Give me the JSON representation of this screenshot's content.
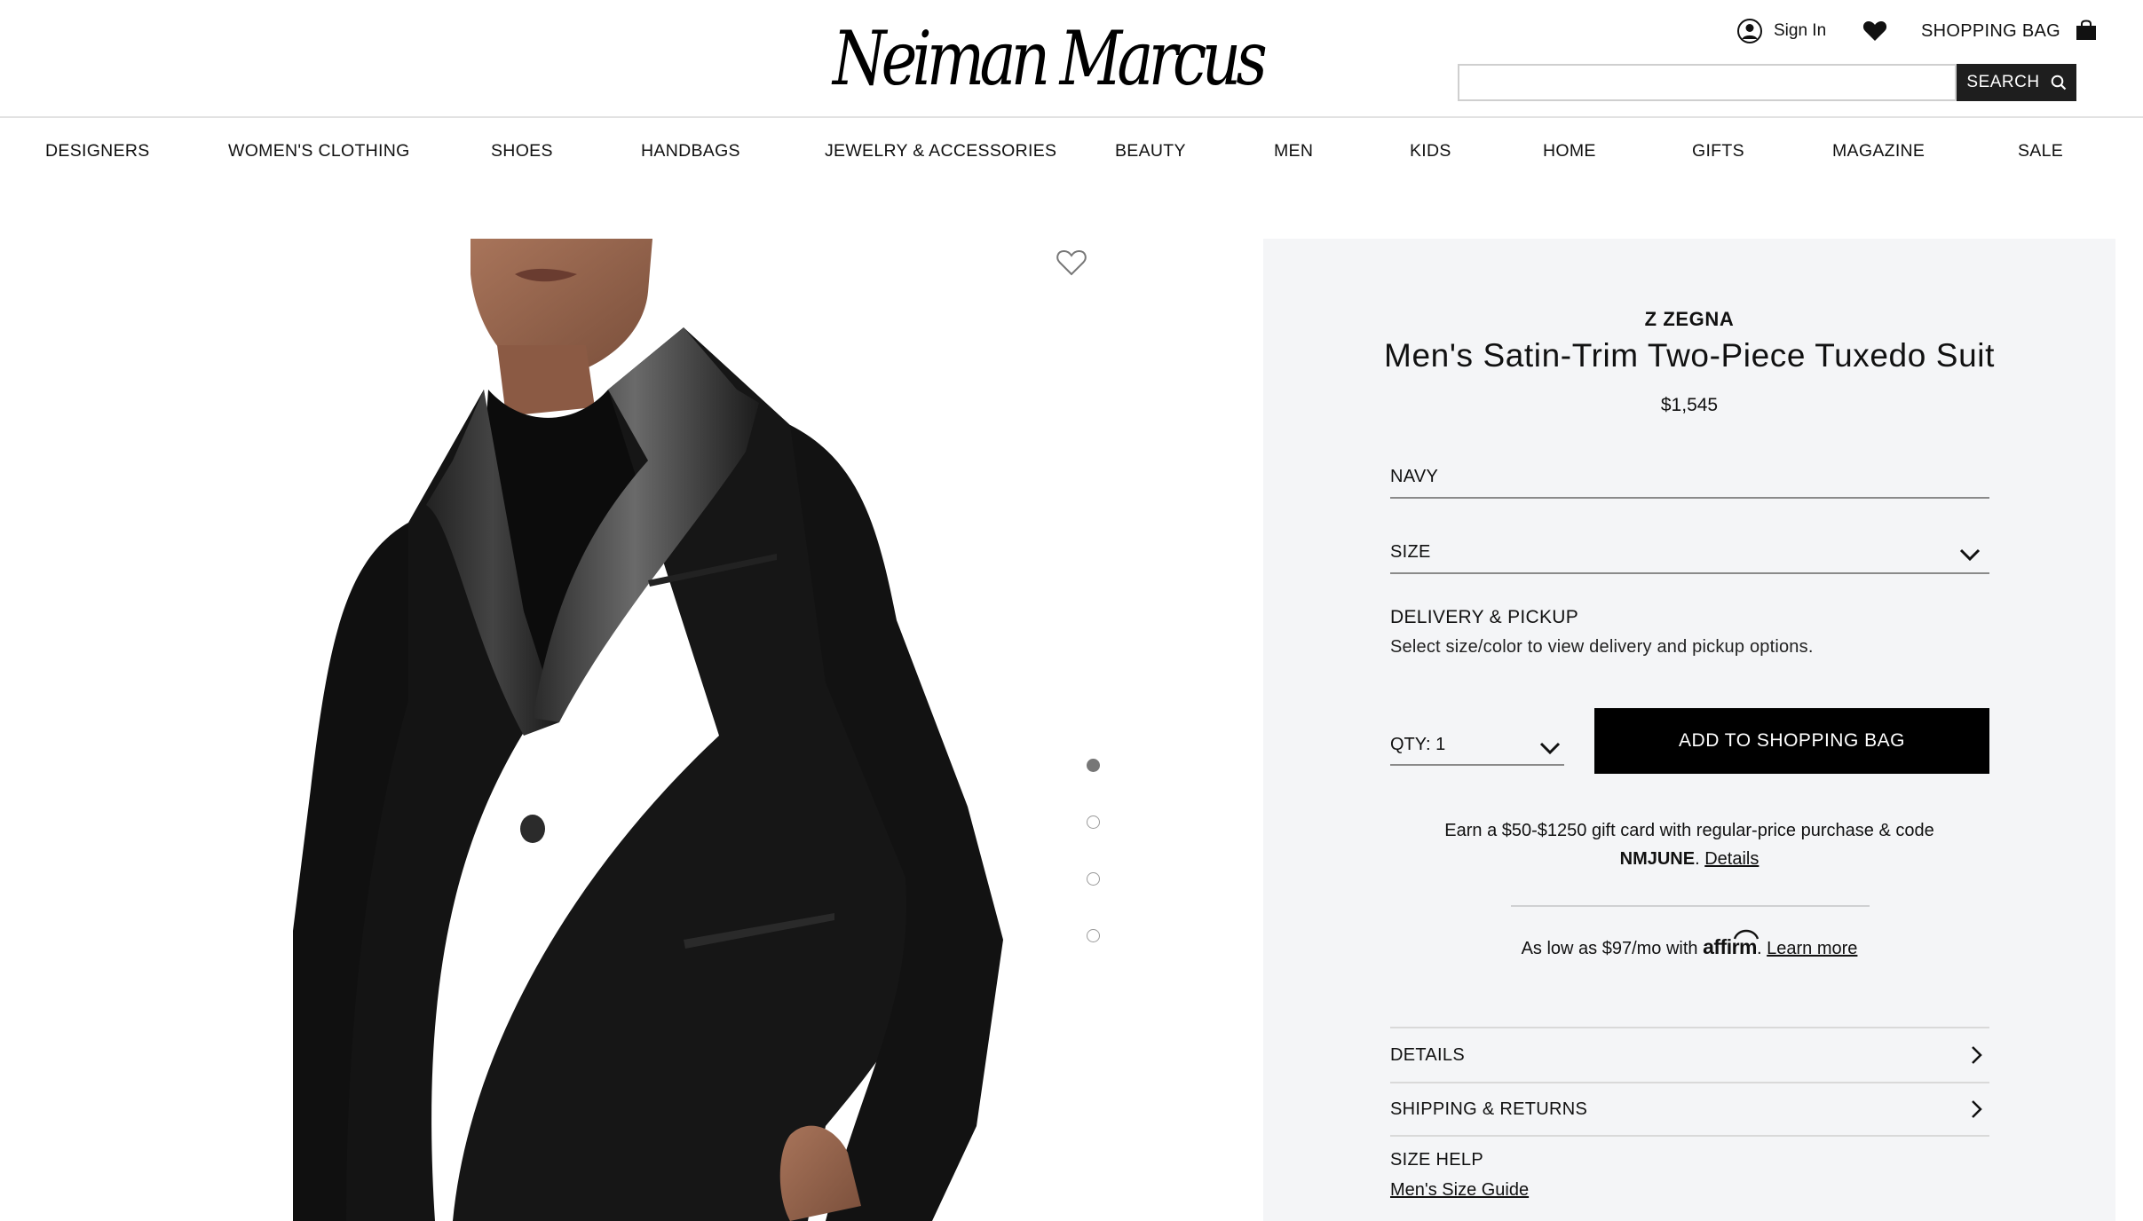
{
  "header": {
    "logo": "Neiman Marcus",
    "sign_in": "Sign In",
    "shopping_bag": "SHOPPING BAG",
    "search_placeholder": "",
    "search_button": "SEARCH",
    "icons": [
      "user-icon",
      "heart-icon",
      "bag-icon",
      "search-icon"
    ]
  },
  "nav": {
    "items": [
      "DESIGNERS",
      "WOMEN'S CLOTHING",
      "SHOES",
      "HANDBAGS",
      "JEWELRY & ACCESSORIES",
      "BEAUTY",
      "MEN",
      "KIDS",
      "HOME",
      "GIFTS",
      "MAGAZINE",
      "SALE"
    ]
  },
  "gallery": {
    "image_count": 4,
    "active_index": 0
  },
  "product": {
    "brand": "Z ZEGNA",
    "title": "Men's Satin-Trim Two-Piece Tuxedo Suit",
    "price": "$1,545",
    "color": "NAVY",
    "size_label": "SIZE",
    "delivery_heading": "DELIVERY & PICKUP",
    "delivery_text": "Select size/color to view delivery and pickup options.",
    "qty_label": "QTY: 1",
    "add_to_bag": "ADD TO SHOPPING BAG",
    "promo_text": "Earn a $50-$1250 gift card with regular-price purchase & code",
    "promo_code": "NMJUNE",
    "promo_sep": ".",
    "promo_link": "Details",
    "affirm_prefix": "As low as $97/mo with",
    "affirm_brand": "affirm",
    "affirm_sep": ".",
    "affirm_link": "Learn more",
    "accordion": [
      "DETAILS",
      "SHIPPING & RETURNS"
    ],
    "size_help_heading": "SIZE HELP",
    "size_guide_link": "Men's Size Guide"
  },
  "colors": {
    "panel_bg": "#f4f5f7",
    "button_black": "#000000",
    "search_button_bg": "#1e1e1e"
  }
}
